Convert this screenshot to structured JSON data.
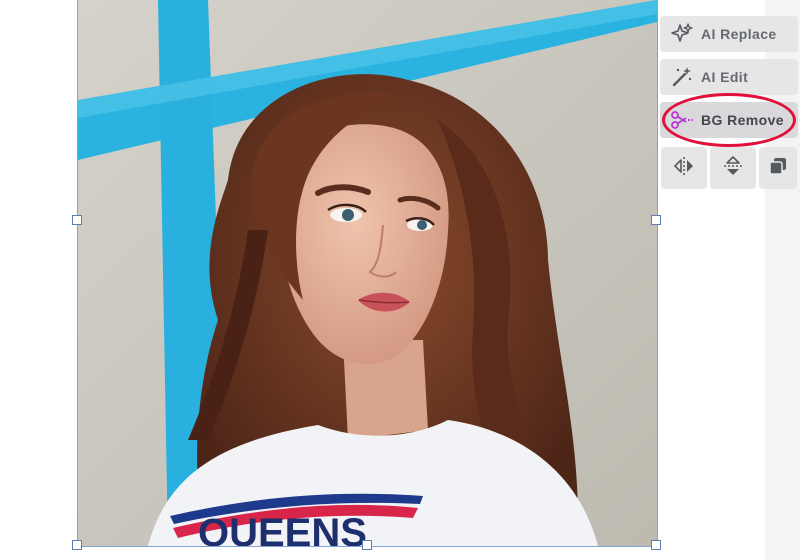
{
  "toolbar": {
    "ai_replace_label": "AI Replace",
    "ai_edit_label": "AI Edit",
    "bg_remove_label": "BG Remove",
    "icons": {
      "ai_replace": "sparkles-icon",
      "ai_edit": "magic-wand-icon",
      "bg_remove": "scissors-icon",
      "flip_horizontal": "flip-horizontal-icon",
      "flip_vertical": "flip-vertical-icon",
      "duplicate": "duplicate-icon"
    },
    "highlighted": "bg_remove"
  },
  "colors": {
    "highlight_ring": "#e0103a",
    "button_bg": "#e6e6e7",
    "button_text": "#666a70",
    "scissors_accent": "#b73ad6",
    "selection": "#7ea4d8"
  },
  "photo": {
    "shirt_text": "QUEENS"
  }
}
